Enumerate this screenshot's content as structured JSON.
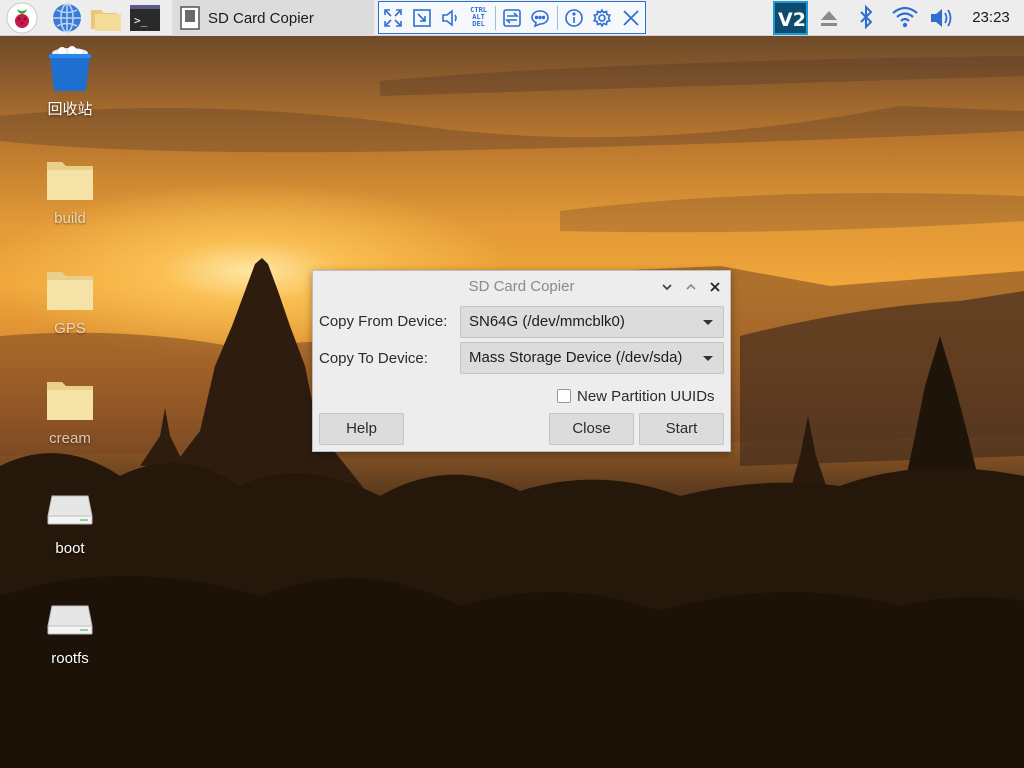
{
  "taskbar": {
    "launchers": [
      {
        "name": "raspberry-menu",
        "icon": "raspberry-icon"
      },
      {
        "name": "web-browser",
        "icon": "globe-icon"
      },
      {
        "name": "file-manager",
        "icon": "folder-icon"
      },
      {
        "name": "terminal",
        "icon": "terminal-icon",
        "glyph": ">_"
      }
    ],
    "task": {
      "label": "SD Card Copier",
      "icon": "document-icon"
    },
    "vnc_toolbar": {
      "buttons": [
        "fullscreen-icon",
        "scale-icon",
        "volume-icon",
        "ctrl-alt-del-icon",
        "transfer-icon",
        "chat-icon",
        "info-icon",
        "gear-icon",
        "close-icon"
      ],
      "ctrl_alt_del_lines": [
        "CTRL",
        "ALT",
        "DEL"
      ]
    },
    "tray": {
      "vnc_label": "V2",
      "icons": [
        "eject-icon",
        "bluetooth-icon",
        "wifi-icon",
        "speaker-icon"
      ],
      "clock": "23:23"
    }
  },
  "desktop": {
    "icons": [
      {
        "label": "回收站",
        "icon": "trash-icon"
      },
      {
        "label": "build",
        "icon": "folder-icon"
      },
      {
        "label": "GPS",
        "icon": "folder-icon"
      },
      {
        "label": "cream",
        "icon": "folder-icon"
      },
      {
        "label": "boot",
        "icon": "drive-icon"
      },
      {
        "label": "rootfs",
        "icon": "drive-icon"
      }
    ]
  },
  "dialog": {
    "title": "SD Card Copier",
    "copy_from_label": "Copy From Device:",
    "copy_from_value": "SN64G  (/dev/mmcblk0)",
    "copy_to_label": "Copy To Device:",
    "copy_to_value": "Mass Storage Device  (/dev/sda)",
    "new_partition_uuids_label": "New Partition UUIDs",
    "new_partition_uuids_checked": false,
    "help_label": "Help",
    "close_label": "Close",
    "start_label": "Start"
  },
  "colors": {
    "accent": "#2f6fd2",
    "taskbar": "#ededed",
    "dialog_bg": "#ededed",
    "button_bg": "#dcdcdc"
  }
}
